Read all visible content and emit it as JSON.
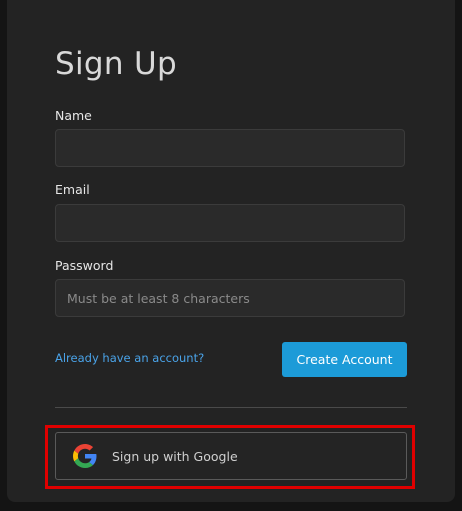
{
  "form": {
    "title": "Sign Up",
    "name_label": "Name",
    "name_value": "",
    "email_label": "Email",
    "email_value": "",
    "password_label": "Password",
    "password_placeholder": "Must be at least 8 characters",
    "signin_link": "Already have an account?",
    "submit_label": "Create Account"
  },
  "google": {
    "label": "Sign up with Google",
    "icon": "google-icon"
  },
  "colors": {
    "accent": "#1c9bd8",
    "link": "#4aa3e8",
    "highlight": "#e00000"
  }
}
